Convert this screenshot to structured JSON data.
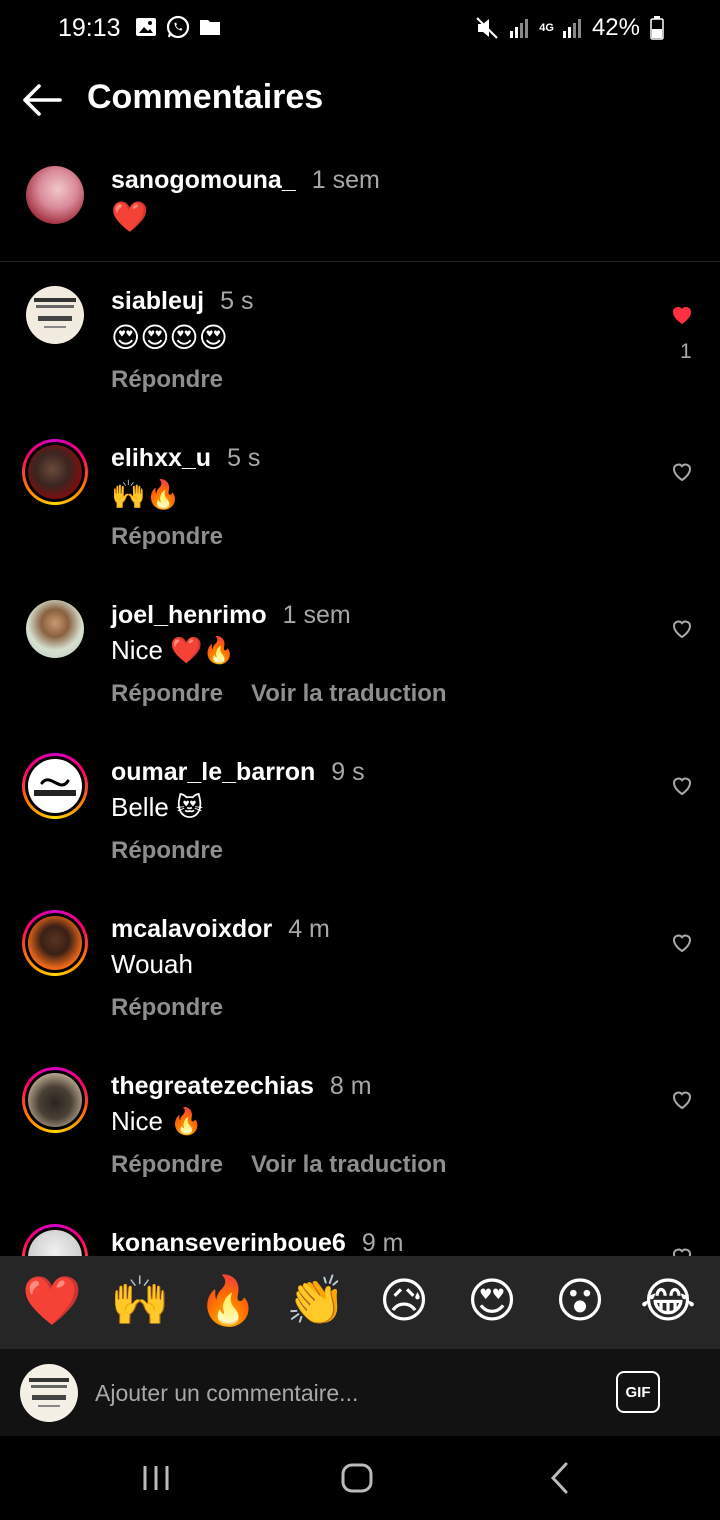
{
  "status_bar": {
    "time": "19:13",
    "battery": "42%",
    "network_label": "4G",
    "icons": [
      "gallery-icon",
      "whatsapp-icon",
      "folder-icon",
      "mute-icon",
      "signal-icon",
      "battery-icon"
    ]
  },
  "header": {
    "title": "Commentaires",
    "back_icon": "arrow-left-icon"
  },
  "caption": {
    "username": "sanogomouna_",
    "time": "1 sem",
    "text": "❤️"
  },
  "comments": [
    {
      "username": "siableuj",
      "time": "5 s",
      "text": "😍😍😍😍",
      "reply": "Répondre",
      "translate": "",
      "liked": true,
      "like_count": "1"
    },
    {
      "username": "elihxx_u",
      "time": "5 s",
      "text": "🙌🔥",
      "reply": "Répondre",
      "translate": "",
      "liked": false,
      "like_count": ""
    },
    {
      "username": "joel_henrimo",
      "time": "1 sem",
      "text": "Nice ❤️🔥",
      "reply": "Répondre",
      "translate": "Voir la traduction",
      "liked": false,
      "like_count": ""
    },
    {
      "username": "oumar_le_barron",
      "time": "9 s",
      "text": "Belle 😻",
      "reply": "Répondre",
      "translate": "",
      "liked": false,
      "like_count": ""
    },
    {
      "username": "mcalavoixdor",
      "time": "4 m",
      "text": "Wouah",
      "reply": "Répondre",
      "translate": "",
      "liked": false,
      "like_count": ""
    },
    {
      "username": "thegreatezechias",
      "time": "8 m",
      "text": "Nice 🔥",
      "reply": "Répondre",
      "translate": "Voir la traduction",
      "liked": false,
      "like_count": ""
    },
    {
      "username": "konanseverinboue6",
      "time": "9 m",
      "text": "",
      "reply": "",
      "translate": "",
      "liked": false,
      "like_count": ""
    }
  ],
  "emoji_bar": [
    "❤️",
    "🙌",
    "🔥",
    "👏",
    "😥",
    "😍",
    "😮",
    "😂"
  ],
  "composer": {
    "placeholder": "Ajouter un commentaire...",
    "gif_label": "GIF"
  },
  "colors": {
    "background": "#000000",
    "like_red": "#ff3040",
    "muted_text": "#a8a8a8",
    "emoji_bar_bg": "#262626"
  }
}
